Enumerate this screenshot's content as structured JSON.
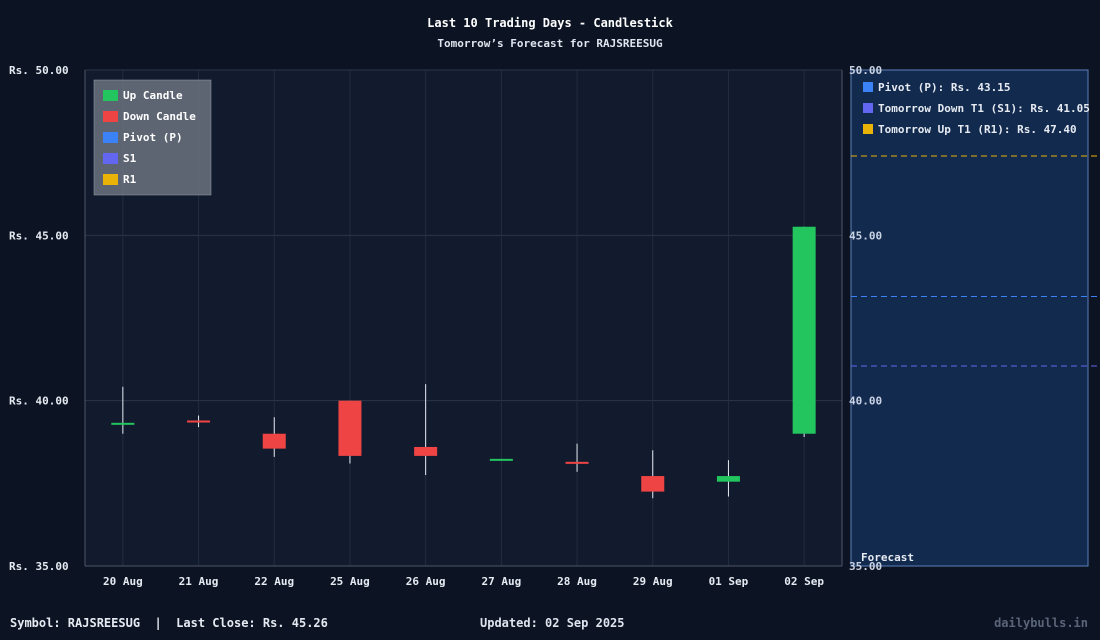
{
  "chart_data": {
    "type": "candlestick",
    "title": "Last 10 Trading Days - Candlestick",
    "subtitle": "Tomorrow’s Forecast for RAJSREESUG",
    "ylim": [
      35,
      50
    ],
    "y_ticks": [
      "Rs. 50.00",
      "Rs. 45.00",
      "Rs. 40.00",
      "Rs. 35.00"
    ],
    "y_tick_values": [
      50,
      45,
      40,
      35
    ],
    "right_ticks": [
      "50.00",
      "45.00",
      "40.00",
      "35.00"
    ],
    "categories": [
      "20 Aug",
      "21 Aug",
      "22 Aug",
      "25 Aug",
      "26 Aug",
      "27 Aug",
      "28 Aug",
      "29 Aug",
      "01 Sep",
      "02 Sep"
    ],
    "candles": [
      {
        "date": "20 Aug",
        "open": 39.28,
        "close": 39.33,
        "high": 40.42,
        "low": 39.0
      },
      {
        "date": "21 Aug",
        "open": 39.4,
        "close": 39.35,
        "high": 39.55,
        "low": 39.2
      },
      {
        "date": "22 Aug",
        "open": 39.0,
        "close": 38.55,
        "high": 39.5,
        "low": 38.3
      },
      {
        "date": "25 Aug",
        "open": 40.0,
        "close": 38.33,
        "high": 40.0,
        "low": 38.1
      },
      {
        "date": "26 Aug",
        "open": 38.6,
        "close": 38.33,
        "high": 40.5,
        "low": 37.75
      },
      {
        "date": "27 Aug",
        "open": 38.22,
        "close": 38.24,
        "high": 38.24,
        "low": 38.2
      },
      {
        "date": "28 Aug",
        "open": 38.15,
        "close": 38.12,
        "high": 38.7,
        "low": 37.85
      },
      {
        "date": "29 Aug",
        "open": 37.72,
        "close": 37.25,
        "high": 38.5,
        "low": 37.05
      },
      {
        "date": "01 Sep",
        "open": 37.55,
        "close": 37.72,
        "high": 38.2,
        "low": 37.1
      },
      {
        "date": "02 Sep",
        "open": 39.0,
        "close": 45.26,
        "high": 45.26,
        "low": 38.9
      }
    ],
    "legend": [
      {
        "label": "Up Candle",
        "color": "#22c55e"
      },
      {
        "label": "Down Candle",
        "color": "#ef4444"
      },
      {
        "label": "Pivot (P)",
        "color": "#3b82f6"
      },
      {
        "label": "S1",
        "color": "#6366f1"
      },
      {
        "label": "R1",
        "color": "#eab308"
      }
    ],
    "legend_placement": "top-left",
    "forecast": {
      "label": "Forecast",
      "levels": [
        {
          "label": "Pivot (P): Rs. 43.15",
          "value": 43.15,
          "color": "#3b82f6"
        },
        {
          "label": "Tomorrow Down T1 (S1): Rs. 41.05",
          "value": 41.05,
          "color": "#6366f1"
        },
        {
          "label": "Tomorrow Up T1 (R1): Rs. 47.40",
          "value": 47.4,
          "color": "#eab308"
        }
      ]
    },
    "colors": {
      "up": "#22c55e",
      "down": "#ef4444",
      "background": "#0c1424",
      "plot_bg": "#121b2d",
      "forecast_bg": "#132a4f"
    },
    "grid": true
  },
  "footer": {
    "symbol_info": "Symbol: RAJSREESUG  |  Last Close: Rs. 45.26",
    "updated": "Updated: 02 Sep 2025",
    "brand": "dailybulls.in"
  }
}
